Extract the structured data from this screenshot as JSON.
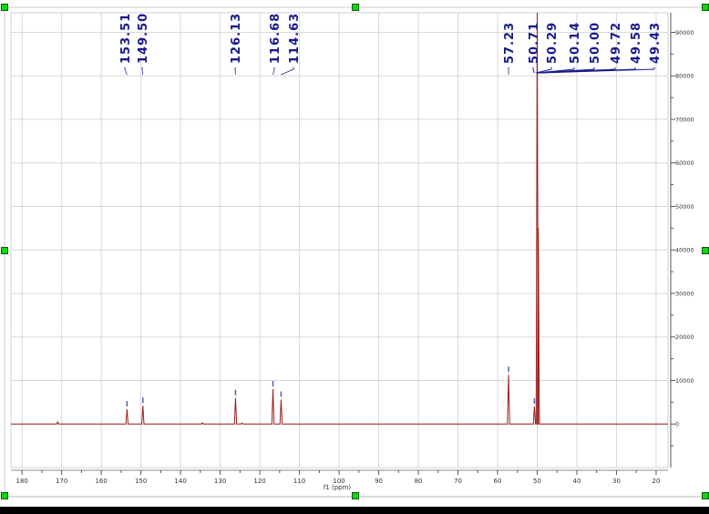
{
  "chart_data": {
    "type": "line",
    "title": "",
    "xlabel": "f1 (ppm)",
    "ylabel": "",
    "xlim": [
      182.8,
      17
    ],
    "ylim": [
      -10000,
      94500
    ],
    "grid": true,
    "x_ticks": [
      180,
      170,
      160,
      150,
      140,
      130,
      120,
      110,
      100,
      90,
      80,
      70,
      60,
      50,
      40,
      30,
      20
    ],
    "y_ticks": [
      0,
      10000,
      20000,
      30000,
      40000,
      50000,
      60000,
      70000,
      80000,
      90000
    ],
    "peaks": [
      {
        "ppm": 171.0,
        "height": 500
      },
      {
        "ppm": 153.51,
        "height": 3400
      },
      {
        "ppm": 149.5,
        "height": 4200
      },
      {
        "ppm": 134.5,
        "height": 300
      },
      {
        "ppm": 126.13,
        "height": 6000
      },
      {
        "ppm": 124.5,
        "height": 250
      },
      {
        "ppm": 116.68,
        "height": 8000
      },
      {
        "ppm": 114.63,
        "height": 5600
      },
      {
        "ppm": 57.23,
        "height": 11300
      },
      {
        "ppm": 50.71,
        "height": 4000
      },
      {
        "ppm": 50.0,
        "height": 95000
      },
      {
        "ppm": 49.72,
        "height": 45000
      }
    ],
    "peak_labels": [
      {
        "text": "153.51",
        "ppm": 153.51,
        "group": "a"
      },
      {
        "text": "149.50",
        "ppm": 149.5,
        "group": "b"
      },
      {
        "text": "126.13",
        "ppm": 126.13,
        "group": "c"
      },
      {
        "text": "116.68",
        "ppm": 116.68,
        "group": "d"
      },
      {
        "text": "114.63",
        "ppm": 114.63,
        "group": "d"
      },
      {
        "text": "57.23",
        "ppm": 57.23,
        "group": "e"
      },
      {
        "text": "50.71",
        "ppm": 50.71,
        "group": "f"
      },
      {
        "text": "50.29",
        "ppm": 50.29,
        "group": "f"
      },
      {
        "text": "50.14",
        "ppm": 50.14,
        "group": "f"
      },
      {
        "text": "50.00",
        "ppm": 50.0,
        "group": "f"
      },
      {
        "text": "49.72",
        "ppm": 49.72,
        "group": "f"
      },
      {
        "text": "49.58",
        "ppm": 49.58,
        "group": "f"
      },
      {
        "text": "49.43",
        "ppm": 49.43,
        "group": "f"
      }
    ],
    "colors": {
      "spectrum": "#9b1c1c",
      "labels": "#1a1a8c",
      "grid": "#d8d8d8"
    }
  }
}
